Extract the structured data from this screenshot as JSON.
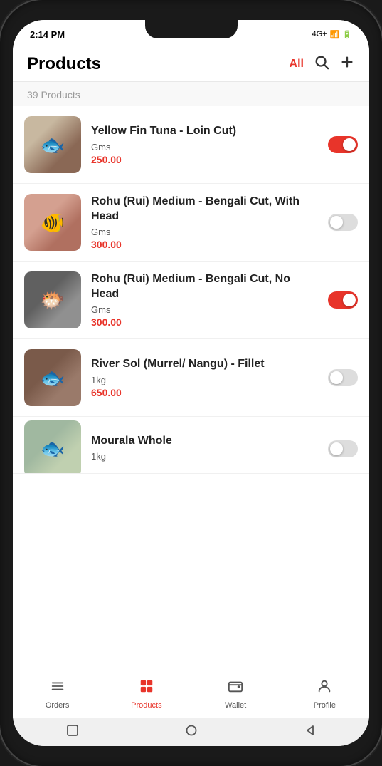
{
  "statusBar": {
    "time": "2:14 PM",
    "signal": "4G+",
    "battery": "🔋"
  },
  "header": {
    "title": "Products",
    "filterAll": "All",
    "searchIcon": "search",
    "addIcon": "plus"
  },
  "productCount": {
    "text": "39 Products"
  },
  "products": [
    {
      "id": 1,
      "name": "Yellow Fin Tuna - Loin Cut)",
      "unit": "Gms",
      "price": "250.00",
      "enabled": true,
      "imgClass": "img-tuna"
    },
    {
      "id": 2,
      "name": "Rohu (Rui) Medium - Bengali Cut, With Head",
      "unit": "Gms",
      "price": "300.00",
      "enabled": false,
      "imgClass": "img-rohu1"
    },
    {
      "id": 3,
      "name": "Rohu (Rui) Medium - Bengali Cut, No Head",
      "unit": "Gms",
      "price": "300.00",
      "enabled": true,
      "imgClass": "img-rohu2"
    },
    {
      "id": 4,
      "name": "River Sol (Murrel/ Nangu) - Fillet",
      "unit": "1kg",
      "price": "650.00",
      "enabled": false,
      "imgClass": "img-sol"
    },
    {
      "id": 5,
      "name": "Mourala Whole",
      "unit": "1kg",
      "price": "",
      "enabled": false,
      "imgClass": "img-mourala",
      "partial": true
    }
  ],
  "bottomNav": {
    "items": [
      {
        "id": "orders",
        "label": "Orders",
        "icon": "≡",
        "active": false
      },
      {
        "id": "products",
        "label": "Products",
        "icon": "⊞",
        "active": true
      },
      {
        "id": "wallet",
        "label": "Wallet",
        "icon": "$",
        "active": false
      },
      {
        "id": "profile",
        "label": "Profile",
        "icon": "👤",
        "active": false
      }
    ]
  },
  "systemBar": {
    "squareBtn": "■",
    "circleBtn": "●",
    "backBtn": "◀"
  }
}
